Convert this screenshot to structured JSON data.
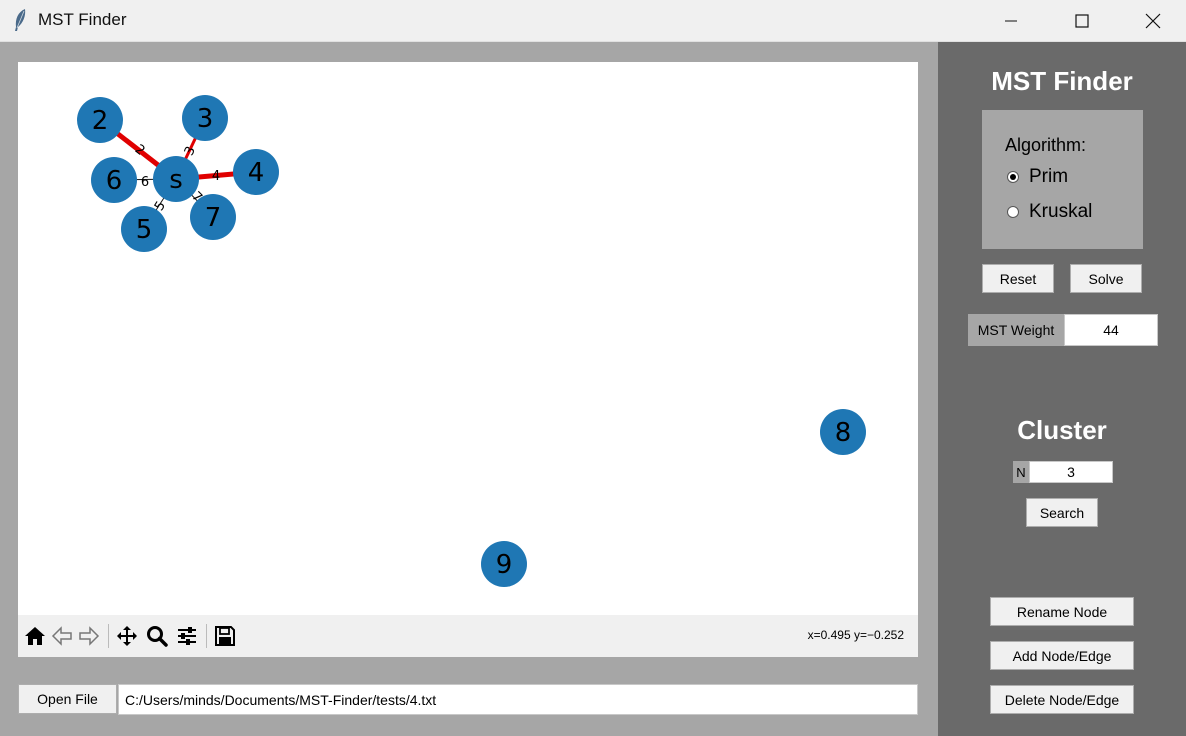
{
  "window": {
    "title": "MST Finder"
  },
  "graph": {
    "nodes": [
      "2",
      "3",
      "6",
      "s",
      "4",
      "7",
      "5",
      "8",
      "9"
    ],
    "edge_weights": [
      "2",
      "3",
      "6",
      "4",
      "5",
      "7"
    ],
    "node_color": "#1f77b4",
    "mst_edge_color": "#e00000"
  },
  "toolbar": {
    "icons": [
      "home-icon",
      "back-arrow-icon",
      "forward-arrow-icon",
      "pan-icon",
      "zoom-icon",
      "configure-subplots-icon",
      "save-icon"
    ],
    "coords": "x=0.495 y=−0.252"
  },
  "file": {
    "open_label": "Open File",
    "path": "C:/Users/minds/Documents/MST-Finder/tests/4.txt"
  },
  "sidebar": {
    "title": "MST Finder",
    "algorithm_label": "Algorithm:",
    "options": [
      "Prim",
      "Kruskal"
    ],
    "selected": "Prim",
    "reset_label": "Reset",
    "solve_label": "Solve",
    "weight_label": "MST Weight",
    "weight_value": "44",
    "cluster_title": "Cluster",
    "n_label": "N",
    "n_value": "3",
    "search_label": "Search",
    "rename_label": "Rename Node",
    "add_label": "Add Node/Edge",
    "delete_label": "Delete Node/Edge"
  }
}
